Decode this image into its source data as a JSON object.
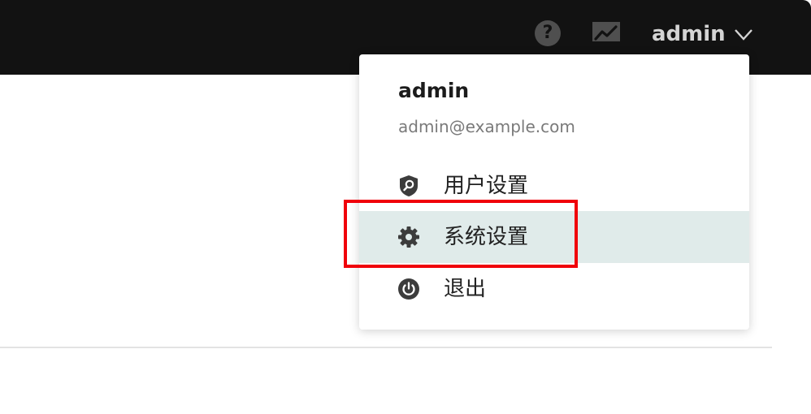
{
  "header": {
    "help_glyph": "?",
    "user_label": "admin"
  },
  "user_menu": {
    "name": "admin",
    "email": "admin@example.com",
    "items": [
      {
        "label": "用户设置",
        "icon": "shield-search-icon"
      },
      {
        "label": "系统设置",
        "icon": "gear-icon",
        "active": true
      },
      {
        "label": "退出",
        "icon": "power-icon"
      }
    ]
  },
  "colors": {
    "topbar": "#121212",
    "active_item_bg": "#e0ebea",
    "highlight_border": "#f0000a"
  }
}
